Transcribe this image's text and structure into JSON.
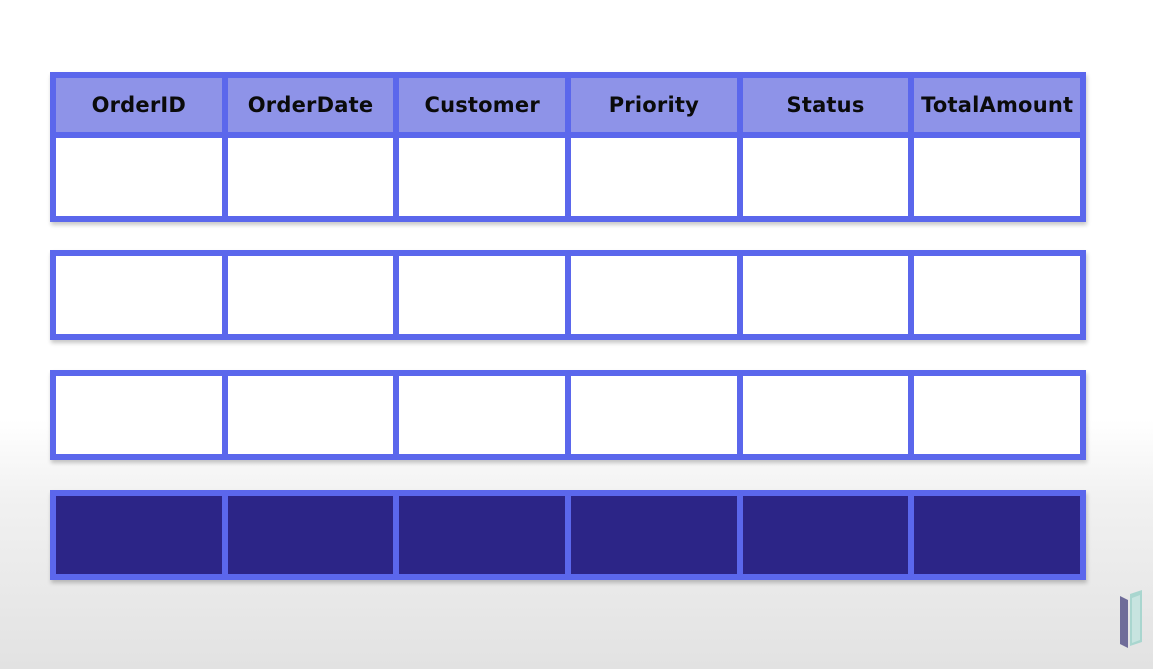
{
  "table": {
    "columns": [
      "OrderID",
      "OrderDate",
      "Customer",
      "Priority",
      "Status",
      "TotalAmount"
    ]
  },
  "rows": [
    {
      "kind": "empty"
    },
    {
      "kind": "empty"
    },
    {
      "kind": "filled"
    }
  ],
  "colors": {
    "border": "#5b67ec",
    "header_fill": "#8e93e8",
    "empty_cell": "#ffffff",
    "filled_cell": "#2c2587",
    "logo_light": "#a9d6cf",
    "logo_dark": "#6f6c99"
  },
  "logo": {
    "icon": "brand-logo-icon"
  }
}
